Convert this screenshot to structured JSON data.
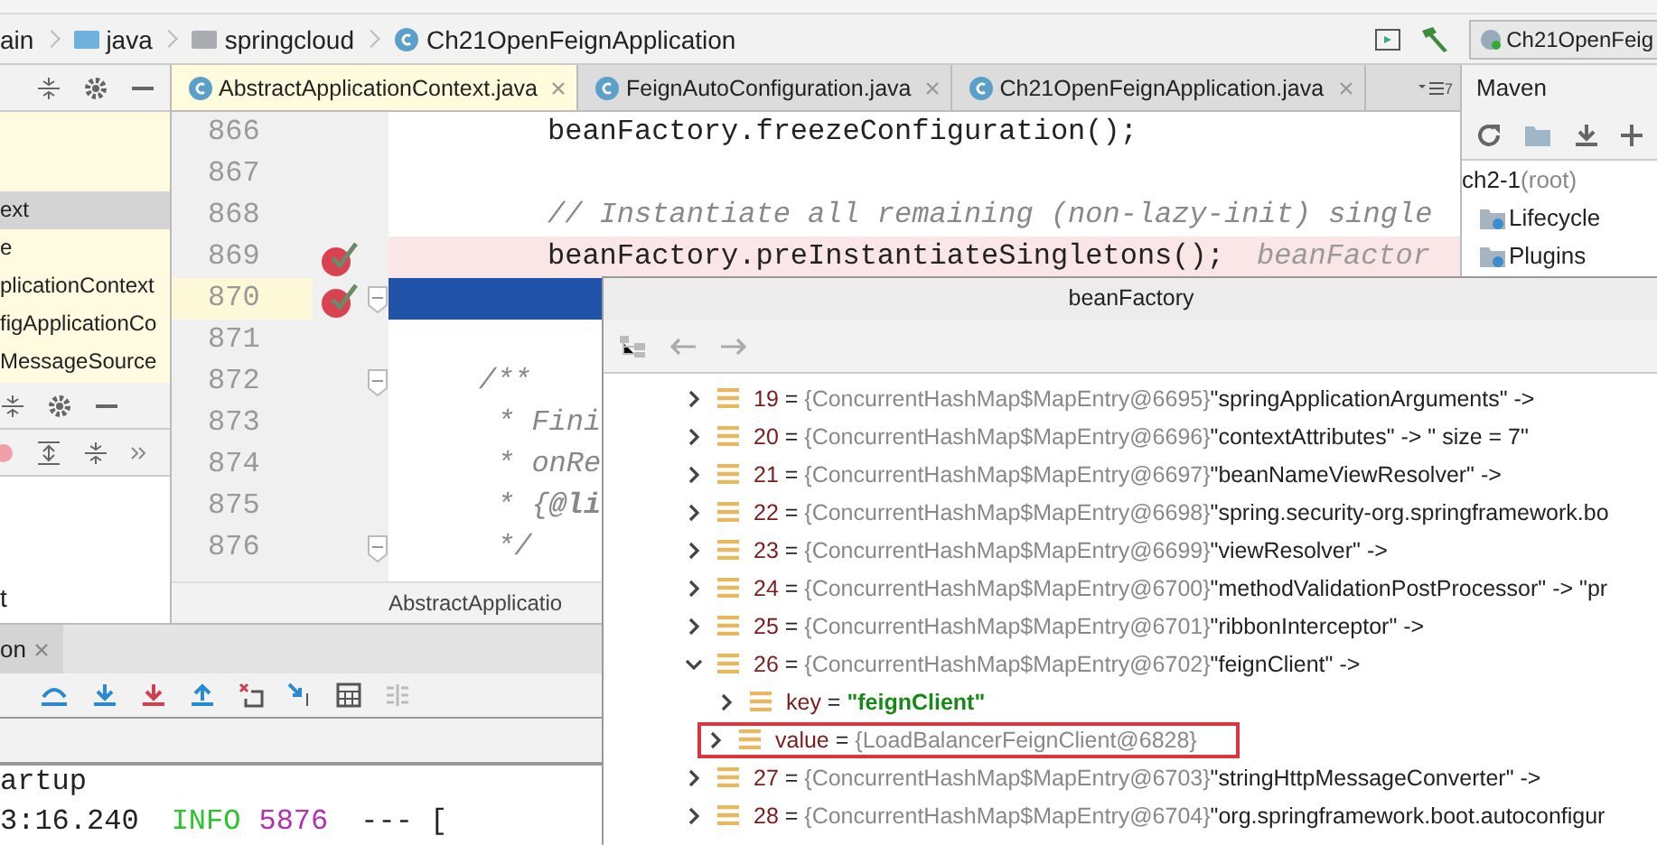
{
  "breadcrumbs": [
    {
      "label": "ain",
      "kind": "text"
    },
    {
      "label": "java",
      "kind": "folder"
    },
    {
      "label": "springcloud",
      "kind": "package"
    },
    {
      "label": "Ch21OpenFeignApplication",
      "kind": "class"
    }
  ],
  "run_config": {
    "label": "Ch21OpenFeig"
  },
  "project_tree": {
    "items": [
      {
        "label": "ext",
        "selected": true
      },
      {
        "label": "e",
        "selected": false
      },
      {
        "label": "plicationContext",
        "selected": false
      },
      {
        "label": "figApplicationCo",
        "selected": false
      },
      {
        "label": "MessageSource",
        "selected": false
      }
    ],
    "footer_item": "t"
  },
  "editor_tabs": [
    {
      "label": "AbstractApplicationContext.java",
      "selected": true
    },
    {
      "label": "FeignAutoConfiguration.java",
      "selected": false
    },
    {
      "label": "Ch21OpenFeignApplication.java",
      "selected": false
    }
  ],
  "tab_overflow_count": "7",
  "code_lines": [
    {
      "number": "866",
      "kind": "statement",
      "code": "beanFactory.freezeConfiguration();",
      "breakpoint": false,
      "fold": false
    },
    {
      "number": "867",
      "kind": "blank",
      "breakpoint": false,
      "fold": false
    },
    {
      "number": "868",
      "kind": "comment",
      "code": "// Instantiate all remaining (non-lazy-init) single",
      "breakpoint": false,
      "fold": false
    },
    {
      "number": "869",
      "kind": "stopped",
      "code": "beanFactory.preInstantiateSingletons();",
      "hint": "beanFactor",
      "breakpoint": true,
      "fold": false
    },
    {
      "number": "870",
      "kind": "execution",
      "breakpoint": true,
      "fold": true
    },
    {
      "number": "871",
      "kind": "blank",
      "breakpoint": false,
      "fold": false
    },
    {
      "number": "872",
      "kind": "doc_open",
      "code": "/**",
      "breakpoint": false,
      "fold": true
    },
    {
      "number": "873",
      "kind": "doc",
      "code": "* Fini",
      "breakpoint": false,
      "fold": false
    },
    {
      "number": "874",
      "kind": "doc",
      "code": "* onRe",
      "breakpoint": false,
      "fold": false
    },
    {
      "number": "875",
      "kind": "doc",
      "code": "* {**@li**",
      "breakpoint": false,
      "fold": false
    },
    {
      "number": "876",
      "kind": "doc",
      "code": "*/",
      "breakpoint": false,
      "fold": true
    }
  ],
  "editor_breadcrumb": "AbstractApplicatio",
  "maven": {
    "title": "Maven",
    "tree": [
      {
        "label": "ch2-1",
        "note": "(root)",
        "kind": "project"
      },
      {
        "label": "Lifecycle",
        "kind": "folder"
      },
      {
        "label": "Plugins",
        "kind": "folder"
      }
    ]
  },
  "bottom_panel": {
    "tab": "on",
    "console": [
      {
        "kind": "plain",
        "text": "artup"
      },
      {
        "kind": "log",
        "time": "3:16.240",
        "level": "INFO",
        "pid": "5876",
        "rest": "--- ["
      }
    ]
  },
  "popup": {
    "title": "beanFactory",
    "assign": "=",
    "rows": [
      {
        "name": "19",
        "ref": "{ConcurrentHashMap$MapEntry@6695}",
        "value": "\"springApplicationArguments\" ->",
        "expanded": false,
        "kind": "entry"
      },
      {
        "name": "20",
        "ref": "{ConcurrentHashMap$MapEntry@6696}",
        "value": "\"contextAttributes\" -> \" size = 7\"",
        "expanded": false,
        "kind": "entry"
      },
      {
        "name": "21",
        "ref": "{ConcurrentHashMap$MapEntry@6697}",
        "value": "\"beanNameViewResolver\" ->",
        "expanded": false,
        "kind": "entry"
      },
      {
        "name": "22",
        "ref": "{ConcurrentHashMap$MapEntry@6698}",
        "value": "\"spring.security-org.springframework.bo",
        "expanded": false,
        "kind": "entry"
      },
      {
        "name": "23",
        "ref": "{ConcurrentHashMap$MapEntry@6699}",
        "value": "\"viewResolver\" ->",
        "expanded": false,
        "kind": "entry"
      },
      {
        "name": "24",
        "ref": "{ConcurrentHashMap$MapEntry@6700}",
        "value": "\"methodValidationPostProcessor\" -> \"pr",
        "expanded": false,
        "kind": "entry"
      },
      {
        "name": "25",
        "ref": "{ConcurrentHashMap$MapEntry@6701}",
        "value": "\"ribbonInterceptor\" ->",
        "expanded": false,
        "kind": "entry"
      },
      {
        "name": "26",
        "ref": "{ConcurrentHashMap$MapEntry@6702}",
        "value": "\"feignClient\" ->",
        "expanded": true,
        "kind": "entry",
        "children": [
          {
            "name": "key",
            "value": "\"feignClient\"",
            "expanded": false,
            "kind": "string"
          },
          {
            "name": "value",
            "ref": "{LoadBalancerFeignClient@6828}",
            "expanded": false,
            "kind": "outlined"
          }
        ]
      },
      {
        "name": "27",
        "ref": "{ConcurrentHashMap$MapEntry@6703}",
        "value": "\"stringHttpMessageConverter\" ->",
        "expanded": false,
        "kind": "entry"
      },
      {
        "name": "28",
        "ref": "{ConcurrentHashMap$MapEntry@6704}",
        "value": "\"org.springframework.boot.autoconfigur",
        "expanded": false,
        "kind": "entry"
      }
    ]
  }
}
